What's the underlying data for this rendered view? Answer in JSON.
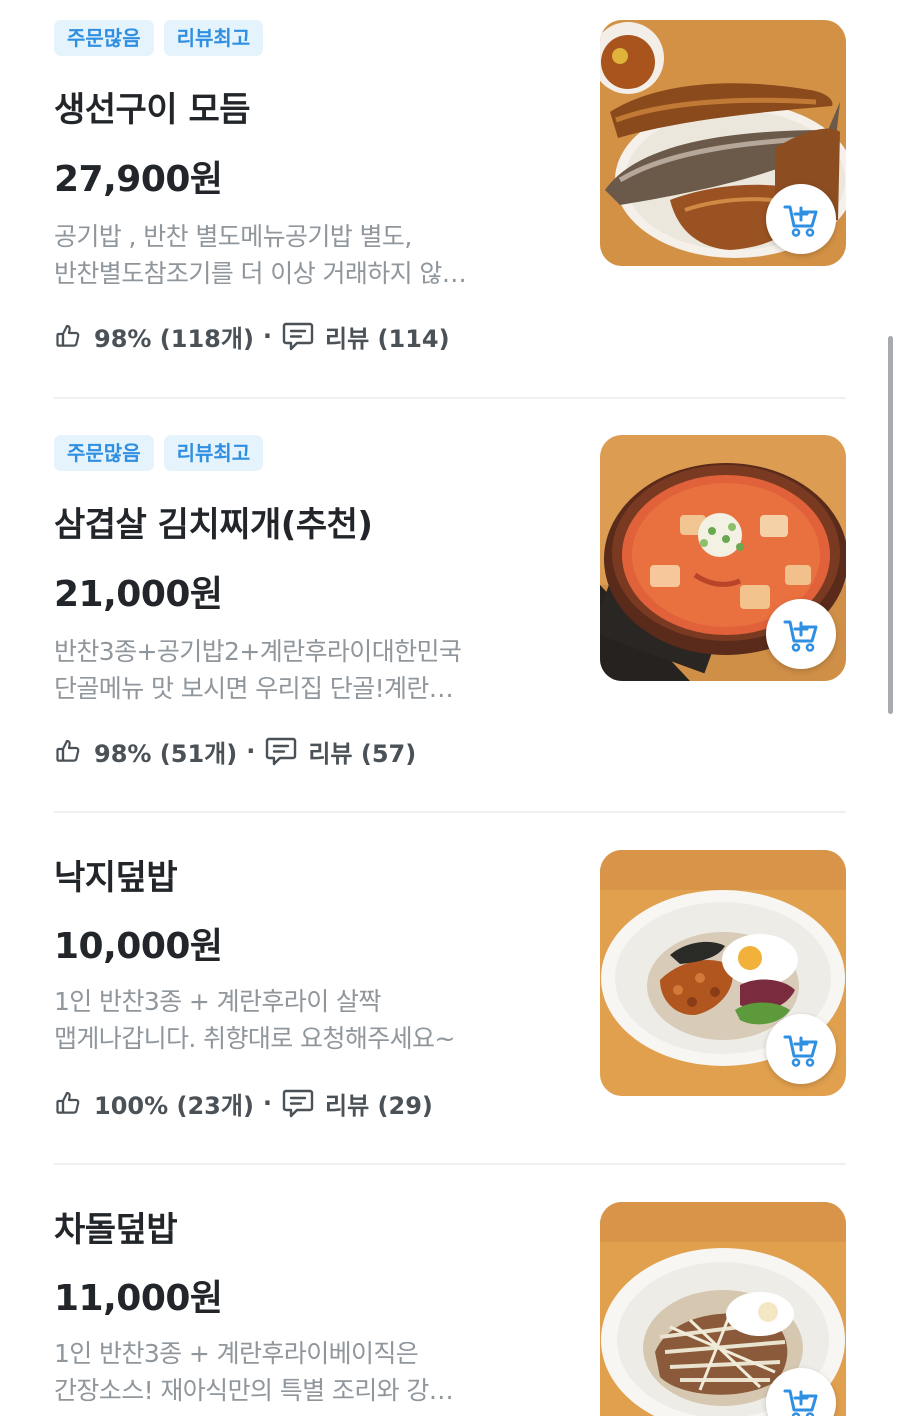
{
  "items": [
    {
      "badges": [
        "주문많음",
        "리뷰최고"
      ],
      "name": "생선구이 모듬",
      "price": "27,900원",
      "desc_line1": "공기밥 , 반찬 별도메뉴공기밥 별도,",
      "desc_line2": "반찬별도참조기를 더 이상 거래하지 않…",
      "rating": "98% (118개)",
      "reviews": "리뷰 (114)",
      "image": "grilled-fish-platter"
    },
    {
      "badges": [
        "주문많음",
        "리뷰최고"
      ],
      "name": "삼겹살 김치찌개(추천)",
      "price": "21,000원",
      "desc_line1": "반찬3종+공기밥2+계란후라이대한민국",
      "desc_line2": "단골메뉴 맛 보시면 우리집 단골!계란…",
      "rating": "98% (51개)",
      "reviews": "리뷰 (57)",
      "image": "kimchi-stew-pot"
    },
    {
      "name": "낙지덮밥",
      "price": "10,000원",
      "desc_line1": "1인 반찬3종 + 계란후라이 살짝",
      "desc_line2": "맵게나갑니다. 취향대로 요청해주세요~",
      "rating": "100% (23개)",
      "reviews": "리뷰 (29)",
      "image": "octopus-rice-bowl"
    },
    {
      "name": "차돌덮밥",
      "price": "11,000원",
      "desc_line1": "1인 반찬3종 + 계란후라이베이직은",
      "desc_line2": "간장소스! 재아식만의 특별 조리와 강…",
      "image": "beef-brisket-rice-bowl"
    }
  ],
  "icons": {
    "like": "thumbs-up-icon",
    "review": "chat-bubble-icon",
    "cart": "cart-add-icon"
  },
  "colors": {
    "accent": "#2f8fe0",
    "badge_bg": "#e5f3fd",
    "text_primary": "#22262a",
    "text_secondary": "#8f969c",
    "divider": "#eef0f2"
  }
}
